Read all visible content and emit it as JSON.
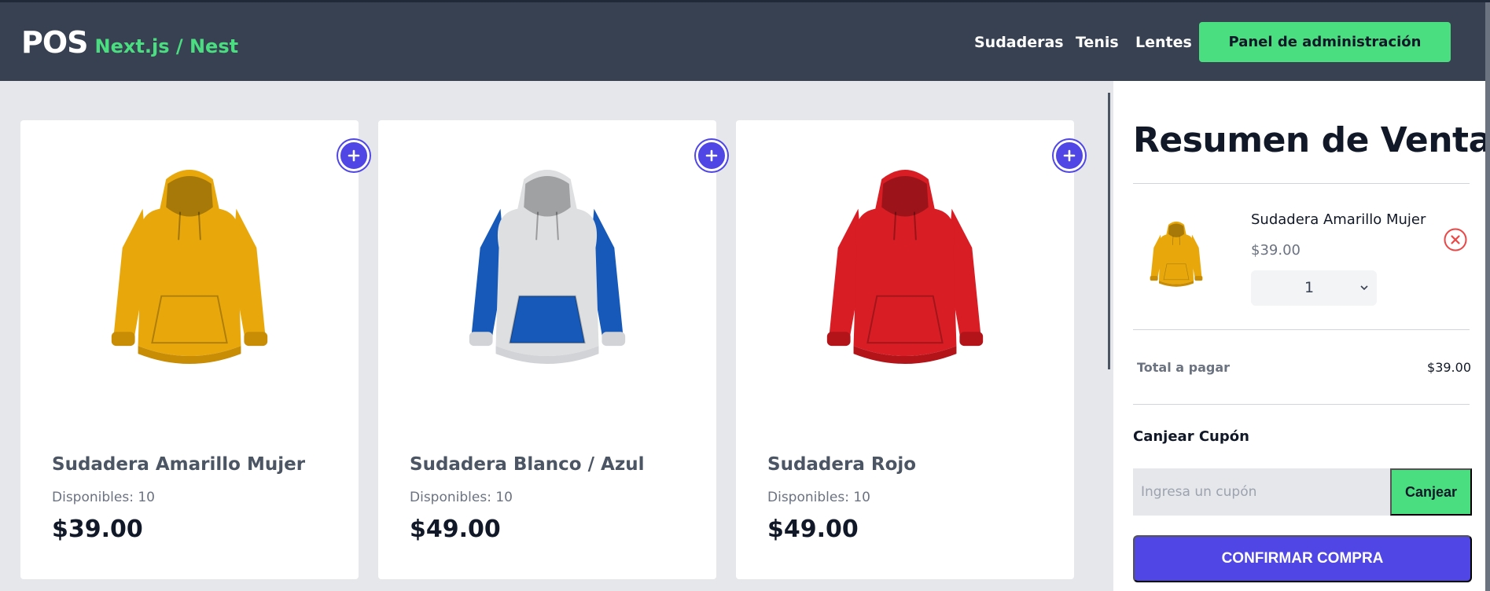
{
  "brand": {
    "name": "POS",
    "tagline": "Next.js / Nest"
  },
  "nav": {
    "items": [
      "Sudaderas",
      "Tenis",
      "Lentes"
    ],
    "admin_label": "Panel de administración"
  },
  "products": [
    {
      "name": "Sudadera Amarillo Mujer",
      "stock": "Disponibles: 10",
      "price": "$39.00",
      "colors": {
        "body": "#e8a80c",
        "sleeves": "#e8a80c",
        "pocket": "#e8a80c",
        "cuffs": "#c88d05"
      }
    },
    {
      "name": "Sudadera Blanco / Azul",
      "stock": "Disponibles: 10",
      "price": "$49.00",
      "colors": {
        "body": "#dedfe1",
        "sleeves": "#1659b8",
        "pocket": "#1659b8",
        "cuffs": "#d1d3d6"
      }
    },
    {
      "name": "Sudadera Rojo",
      "stock": "Disponibles: 10",
      "price": "$49.00",
      "colors": {
        "body": "#d81d24",
        "sleeves": "#d81d24",
        "pocket": "#d81d24",
        "cuffs": "#b3141a"
      }
    }
  ],
  "summary": {
    "title": "Resumen de Venta",
    "item": {
      "name": "Sudadera Amarillo Mujer",
      "price": "$39.00",
      "quantity": "1"
    },
    "total_label": "Total a pagar",
    "total_value": "$39.00",
    "coupon_title": "Canjear Cupón",
    "coupon_placeholder": "Ingresa un cupón",
    "coupon_button": "Canjear",
    "confirm_button": "CONFIRMAR COMPRA"
  },
  "colors": {
    "header": "#374151",
    "accent_green": "#4ade80",
    "accent_indigo": "#4f46e5",
    "remove_red": "#ef4444"
  },
  "icons": {
    "add": "plus-circle-icon",
    "remove": "x-circle-icon",
    "select": "chevron-down-icon"
  }
}
